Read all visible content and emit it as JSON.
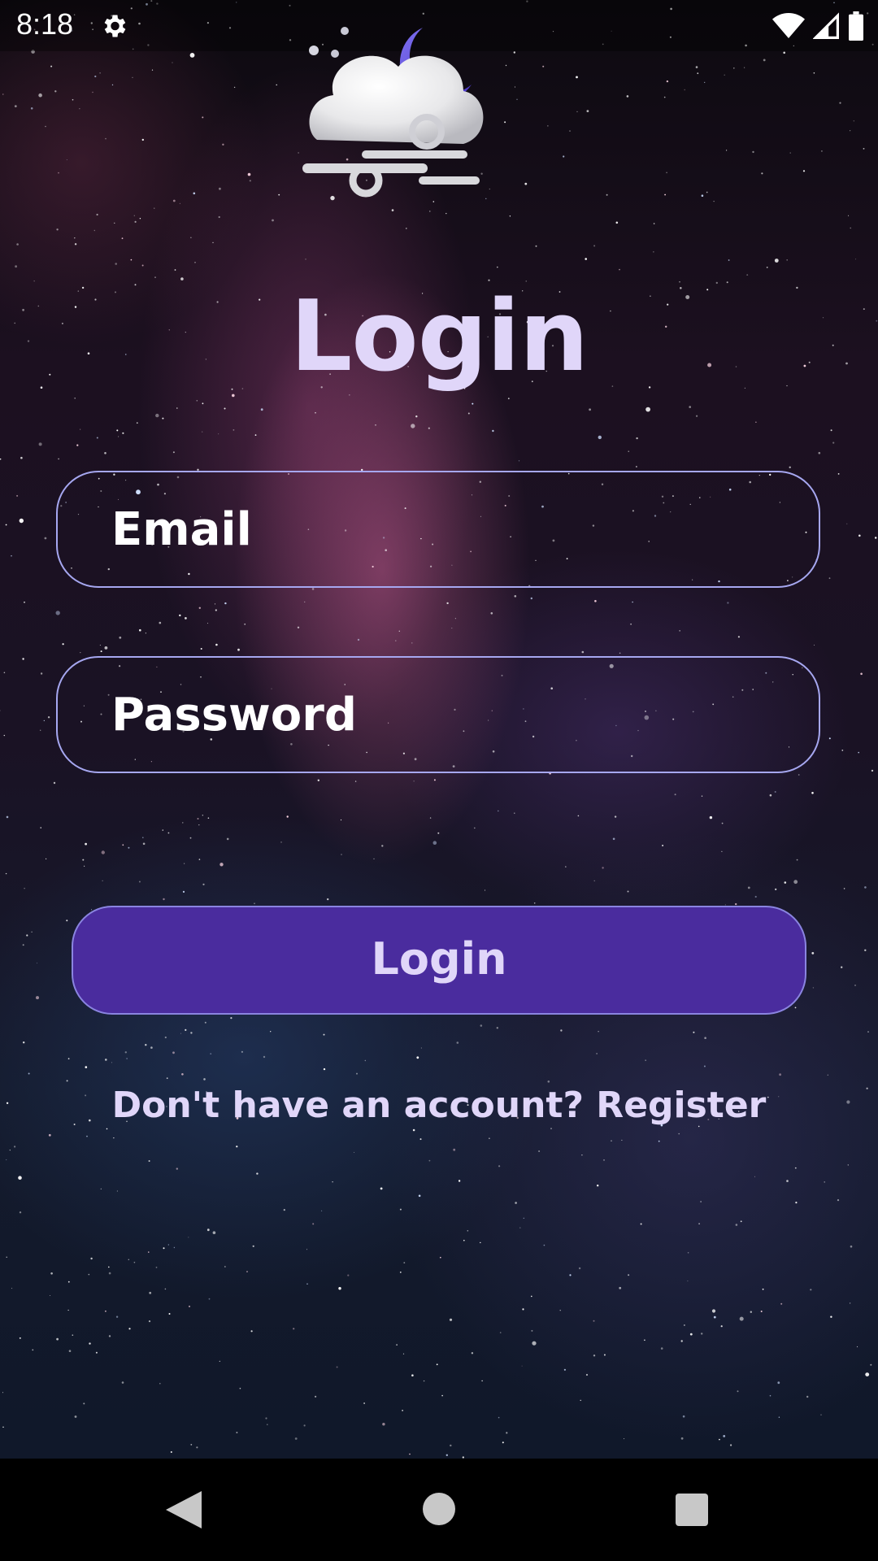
{
  "status_bar": {
    "time": "8:18",
    "icons": [
      "settings-icon",
      "wifi-icon",
      "signal-icon",
      "battery-icon"
    ]
  },
  "logo": {
    "icon": "cloud-moon-wind-icon"
  },
  "title": "Login",
  "form": {
    "email_placeholder": "Email",
    "password_placeholder": "Password",
    "login_label": "Login",
    "register_text": "Don't have an account? Register"
  },
  "colors": {
    "accent_text": "#e0d6f9",
    "button_bg": "#4a2c9e",
    "field_border": "#a6a7f0"
  },
  "nav_bar": {
    "icons": [
      "back-icon",
      "home-icon",
      "recents-icon"
    ]
  }
}
